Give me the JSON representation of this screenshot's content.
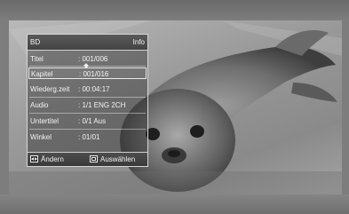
{
  "panel": {
    "title": "BD",
    "info": "Info"
  },
  "rows": [
    {
      "label": "Titel",
      "value": ": 001/006"
    },
    {
      "label": "Kapitel",
      "value": ": 001/016"
    },
    {
      "label": "Wiederg.zeit",
      "value": ": 00:04:17"
    },
    {
      "label": "Audio",
      "value": ": 1/1 ENG 2CH"
    },
    {
      "label": "Untertitel",
      "value": ": 0/1 Aus"
    },
    {
      "label": "Winkel",
      "value": ": 01/01"
    }
  ],
  "footer": {
    "change": "Ändern",
    "select": "Auswählen"
  },
  "icons": {
    "change": "left-right-arrows-icon",
    "select": "enter-icon"
  }
}
